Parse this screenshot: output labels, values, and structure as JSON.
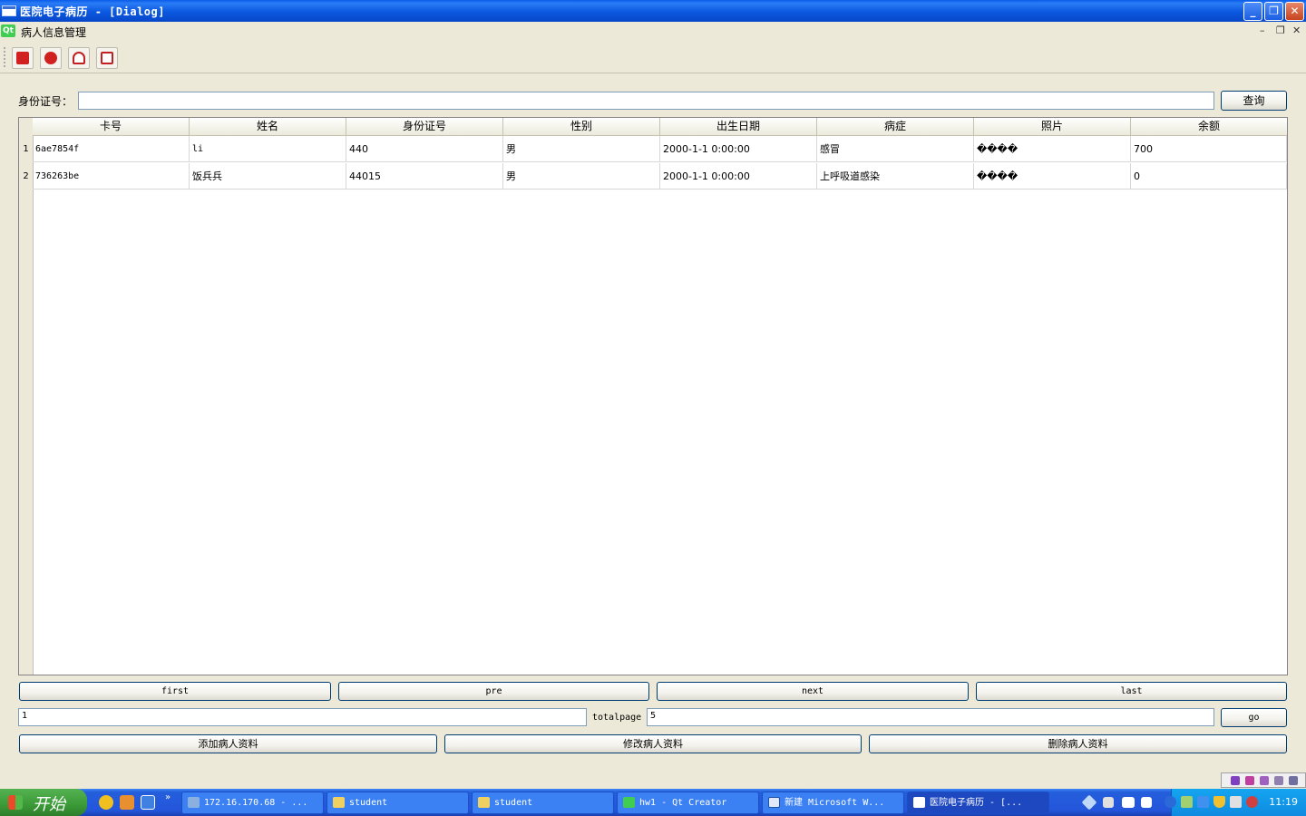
{
  "window": {
    "title": "医院电子病历 - [Dialog]",
    "minimize": "_",
    "restore": "❐",
    "close": "✕"
  },
  "menubar": {
    "app_badge": "Qt",
    "title": "病人信息管理",
    "mdi_min": "–",
    "mdi_restore": "❐",
    "mdi_close": "✕"
  },
  "toolbar": {
    "icons": [
      "camera-icon",
      "pills-icon",
      "doctor-icon",
      "clipboard-icon"
    ],
    "icon_color": "#d12020"
  },
  "search": {
    "label": "身份证号：",
    "value": "",
    "button": "查询"
  },
  "table": {
    "columns": [
      "卡号",
      "姓名",
      "身份证号",
      "性别",
      "出生日期",
      "病症",
      "照片",
      "余额"
    ],
    "rows": [
      {
        "num": "1",
        "cells": [
          "6ae7854f",
          "li",
          "440",
          "男",
          "2000-1-1 0:00:00",
          "感冒",
          "����",
          "700"
        ]
      },
      {
        "num": "2",
        "cells": [
          "736263be",
          "饭兵兵",
          "44015",
          "男",
          "2000-1-1 0:00:00",
          "上呼吸道感染",
          "����",
          "0"
        ]
      }
    ]
  },
  "pager": {
    "first": "first",
    "pre": "pre",
    "next": "next",
    "last": "last",
    "current_page": "1",
    "totalpage_label": "totalpage",
    "totalpage_value": "5",
    "go": "go"
  },
  "actions": {
    "add": "添加病人资料",
    "edit": "修改病人资料",
    "delete": "删除病人资料"
  },
  "taskbar": {
    "start": "开始",
    "quick_launch": [
      "plus-icon",
      "media-icon",
      "desktop-icon"
    ],
    "more": "»",
    "tasks": [
      {
        "label": "172.16.170.68 - ...",
        "icon": "remote-desktop-icon"
      },
      {
        "label": "student",
        "icon": "folder-icon"
      },
      {
        "label": "student",
        "icon": "folder-icon"
      },
      {
        "label": "hw1 - Qt Creator",
        "icon": "qt-creator-icon"
      },
      {
        "label": "新建 Microsoft W...",
        "icon": "word-icon"
      },
      {
        "label": "医院电子病历 - [...",
        "icon": "window-icon"
      }
    ],
    "clock": "11:19"
  },
  "colors": {
    "titlebar": "#0a5ce8",
    "dialog_bg": "#ece9d8",
    "taskbar": "#245edb",
    "start": "#3a9a36",
    "tray": "#0f8ae0"
  }
}
